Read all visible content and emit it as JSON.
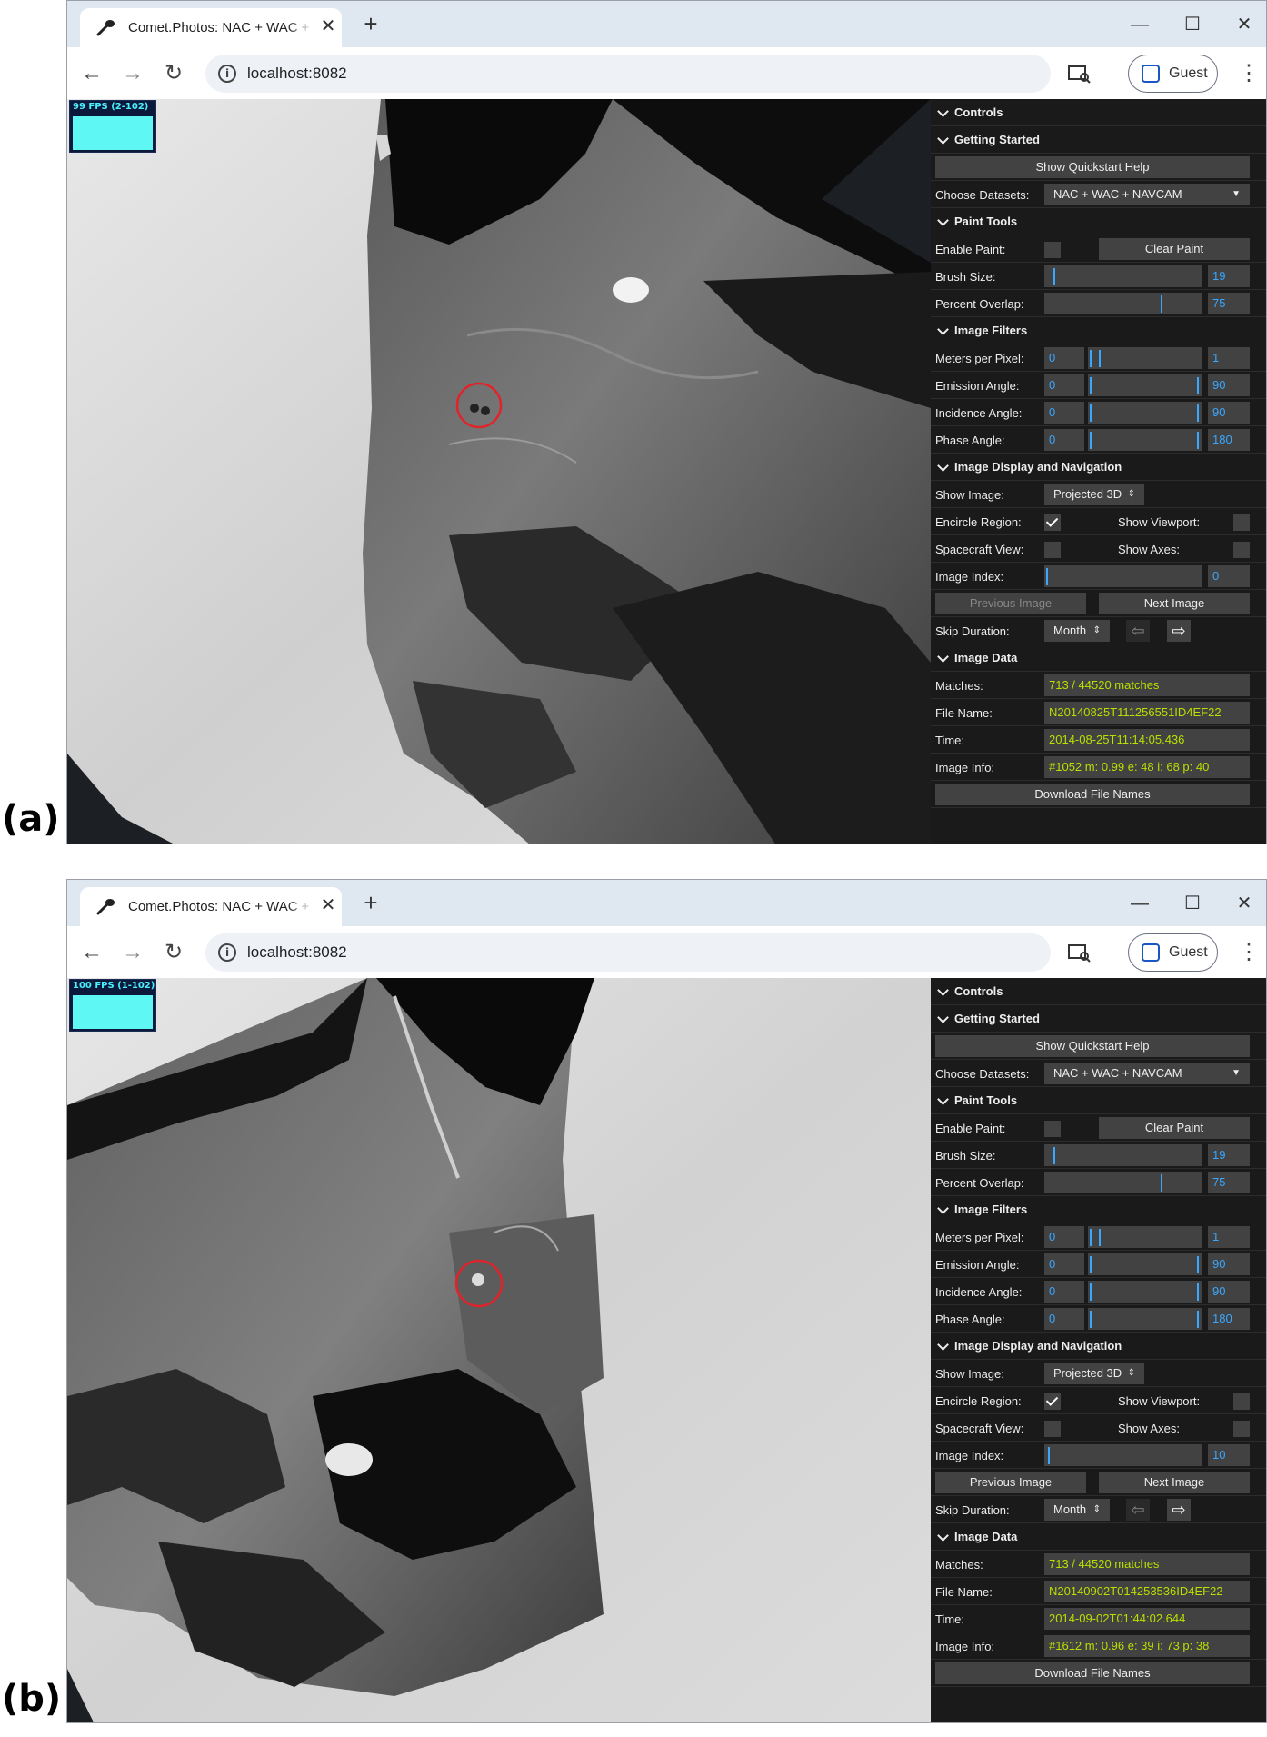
{
  "labels": {
    "a": "(a)",
    "b": "(b)"
  },
  "colors": {
    "fps_text": "#4bf0ff",
    "number": "#3aa7ff",
    "data_text": "#b8e000",
    "gui_bg": "#1a1a1a",
    "tabbar": "#dfe7f1"
  },
  "browser": {
    "tab_title": "Comet.Photos: NAC + WAC + NAVCAM",
    "tab_close": "✕",
    "new_tab": "+",
    "url": "localhost:8082",
    "profile": "Guest",
    "icons": [
      "comet-icon",
      "back-arrow-icon",
      "forward-arrow-icon",
      "reload-icon",
      "info-icon",
      "cast-icon",
      "profile-icon",
      "kebab-menu-icon",
      "minimize-icon",
      "maximize-icon",
      "close-icon"
    ]
  },
  "gui": {
    "controls": "Controls",
    "getting_started": "Getting Started",
    "show_quickstart": "Show Quickstart Help",
    "choose_datasets_label": "Choose Datasets:",
    "datasets_value": "NAC + WAC + NAVCAM",
    "paint_tools": "Paint Tools",
    "enable_paint_label": "Enable Paint:",
    "clear_paint": "Clear Paint",
    "brush_size_label": "Brush Size:",
    "brush_size_value": "19",
    "brush_size_fraction": 0.05,
    "percent_overlap_label": "Percent Overlap:",
    "percent_overlap_value": "75",
    "percent_overlap_fraction": 0.75,
    "image_filters": "Image Filters",
    "meters_per_pixel_label": "Meters per Pixel:",
    "meters_min": "0",
    "meters_max": "1",
    "emission_label": "Emission Angle:",
    "emission_min": "0",
    "emission_max": "90",
    "incidence_label": "Incidence Angle:",
    "incidence_min": "0",
    "incidence_max": "90",
    "phase_label": "Phase Angle:",
    "phase_min": "0",
    "phase_max": "180",
    "display_nav": "Image Display and Navigation",
    "show_image_label": "Show Image:",
    "show_image_value": "Projected 3D",
    "encircle_label": "Encircle Region:",
    "show_viewport_label": "Show Viewport:",
    "spacecraft_label": "Spacecraft View:",
    "show_axes_label": "Show Axes:",
    "image_index_label": "Image Index:",
    "previous_image": "Previous Image",
    "next_image": "Next Image",
    "skip_duration_label": "Skip Duration:",
    "skip_duration_value": "Month",
    "image_data": "Image Data",
    "matches_label": "Matches:",
    "file_name_label": "File Name:",
    "time_label": "Time:",
    "image_info_label": "Image Info:",
    "download": "Download File Names"
  },
  "panel_a": {
    "fps": "99 FPS (2-102)",
    "image_index": "0",
    "image_index_fraction": 0.0,
    "matches": "713 / 44520 matches",
    "file_name": "N20140825T111256551ID4EF22",
    "time": "2014-08-25T11:14:05.436",
    "image_info": "#1052  m: 0.99  e: 48  i: 68  p: 40"
  },
  "panel_b": {
    "fps": "100 FPS (1-102)",
    "image_index": "10",
    "image_index_fraction": 0.014,
    "matches": "713 / 44520 matches",
    "file_name": "N20140902T014253536ID4EF22",
    "time": "2014-09-02T01:44:02.644",
    "image_info": "#1612  m: 0.96  e: 39  i: 73  p: 38"
  }
}
